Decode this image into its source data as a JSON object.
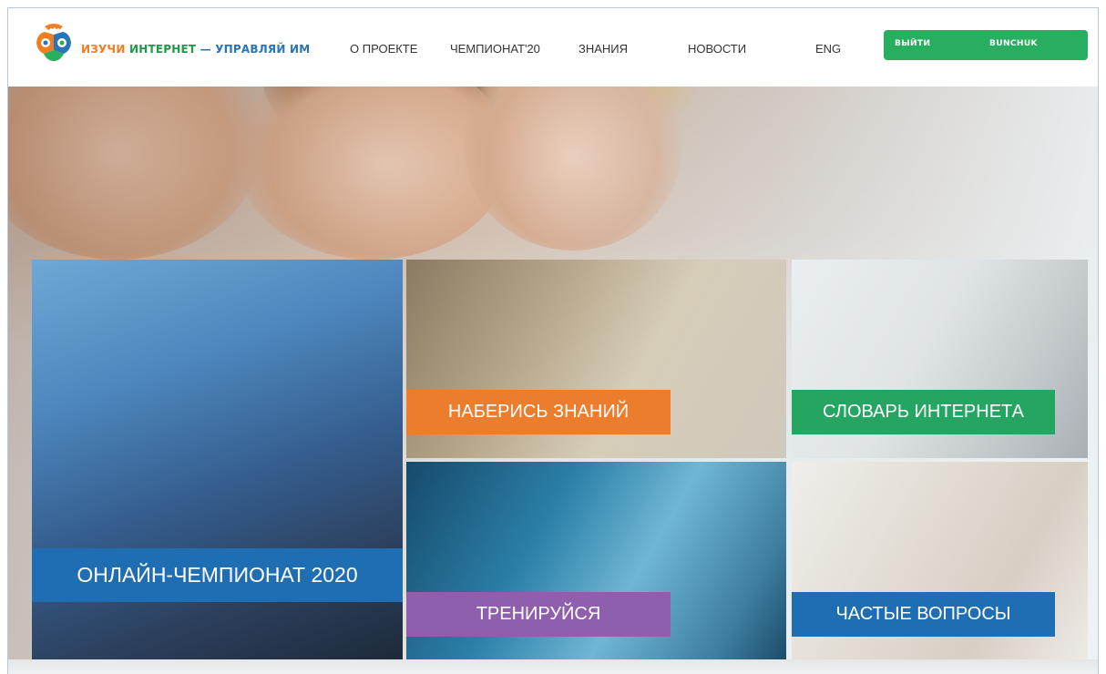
{
  "header": {
    "logo": {
      "icon": "brain-logo-icon",
      "text_part1": "ИЗУЧИ ",
      "text_part2": "ИНТЕРНЕТ",
      "text_part3": " — УПРАВЛЯЙ ИМ"
    },
    "nav": [
      "О ПРОЕКТЕ",
      "ЧЕМПИОНАТ'20",
      "ЗНАНИЯ",
      "НОВОСТИ",
      "ENG"
    ],
    "auth": {
      "logout_label": "ВЫЙТИ",
      "username": "BUNCHUK"
    },
    "colors": {
      "orange": "#ef7d22",
      "green": "#1f9a4a",
      "blue": "#2a74b8",
      "auth_bg": "#27ae5f"
    }
  },
  "tiles": [
    {
      "id": "championship",
      "label": "ОНЛАЙН-ЧЕМПИОНАТ 2020",
      "color": "#1f6eb4"
    },
    {
      "id": "knowledge",
      "label": "НАБЕРИСЬ ЗНАНИЙ",
      "color": "#ec7d2d"
    },
    {
      "id": "dictionary",
      "label": "СЛОВАРЬ ИНТЕРНЕТА",
      "color": "#25a562"
    },
    {
      "id": "training",
      "label": "ТРЕНИРУЙСЯ",
      "color": "#8e5fad"
    },
    {
      "id": "faq",
      "label": "ЧАСТЫЕ ВОПРОСЫ",
      "color": "#1f6eb4"
    }
  ]
}
